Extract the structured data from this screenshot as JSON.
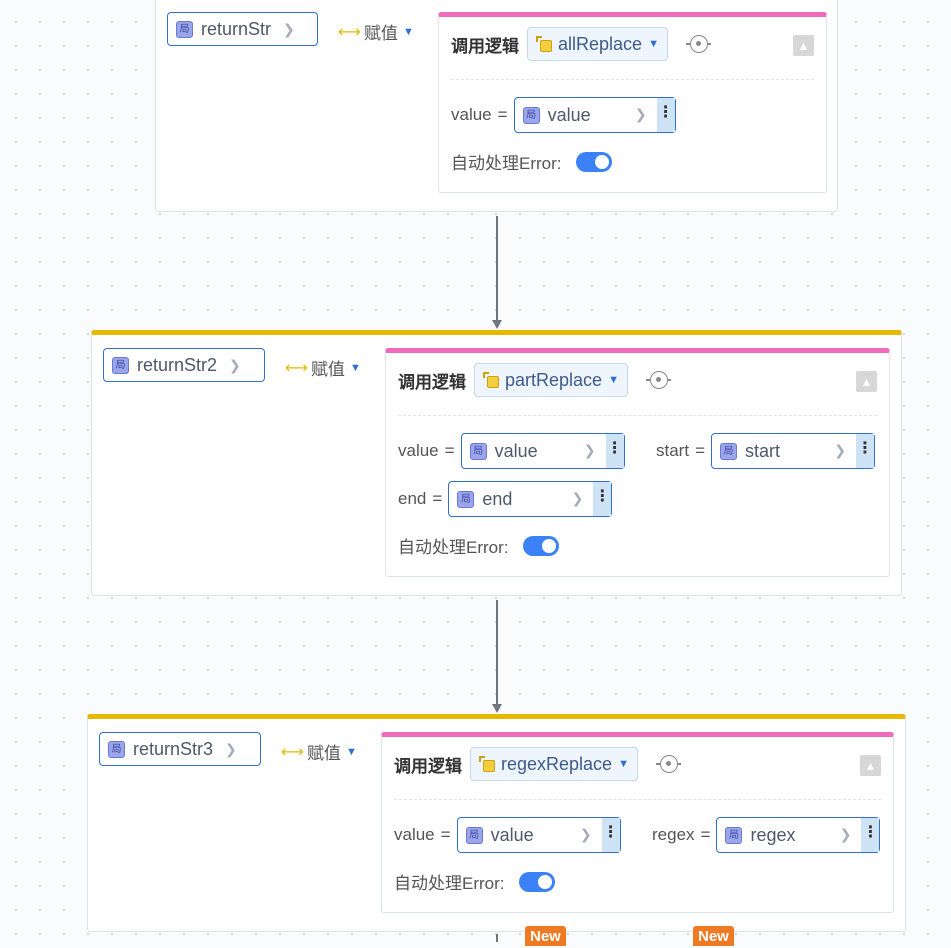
{
  "nodes": [
    {
      "variable": "returnStr",
      "assign_label": "赋值",
      "call_title": "调用逻辑",
      "logic": "allReplace",
      "params": [
        {
          "name": "value",
          "var": "value"
        }
      ],
      "auto_error_label": "自动处理Error:",
      "auto_error_on": true
    },
    {
      "variable": "returnStr2",
      "assign_label": "赋值",
      "call_title": "调用逻辑",
      "logic": "partReplace",
      "params": [
        {
          "name": "value",
          "var": "value"
        },
        {
          "name": "start",
          "var": "start"
        },
        {
          "name": "end",
          "var": "end"
        }
      ],
      "auto_error_label": "自动处理Error:",
      "auto_error_on": true
    },
    {
      "variable": "returnStr3",
      "assign_label": "赋值",
      "call_title": "调用逻辑",
      "logic": "regexReplace",
      "params": [
        {
          "name": "value",
          "var": "value"
        },
        {
          "name": "regex",
          "var": "regex"
        }
      ],
      "auto_error_label": "自动处理Error:",
      "auto_error_on": true
    }
  ],
  "local_icon_glyph": "局",
  "new_badges": [
    "New",
    "New"
  ],
  "colors": {
    "accent_blue": "#2f6fd1",
    "node_top": "#e6b800",
    "call_top": "#f06bbd",
    "new_badge": "#f07a23"
  }
}
